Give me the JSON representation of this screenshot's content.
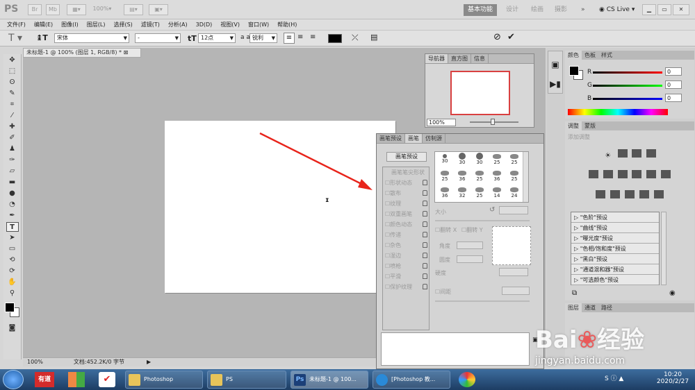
{
  "app": {
    "logo": "PS",
    "zoom": "100%",
    "workspaces": [
      "基本功能",
      "设计",
      "绘画",
      "摄影"
    ],
    "cslive": "CS Live"
  },
  "menu": [
    "文件(F)",
    "编辑(E)",
    "图像(I)",
    "图层(L)",
    "选择(S)",
    "滤镜(T)",
    "分析(A)",
    "3D(D)",
    "视图(V)",
    "窗口(W)",
    "帮助(H)"
  ],
  "options": {
    "font_family": "宋体",
    "font_style": "-",
    "font_size": "12点",
    "aa_label": "a a",
    "antialias": "锐利"
  },
  "document": {
    "tab": "未标题-1 @ 100% (图层 1, RGB/8) *",
    "zoom": "100%",
    "status": "文档:452.2K/0 字节"
  },
  "navigator": {
    "tabs": [
      "导航器",
      "直方图",
      "信息"
    ],
    "zoom": "100%"
  },
  "brush": {
    "tabs": [
      "画笔预设",
      "画笔",
      "仿制源"
    ],
    "preset_button": "画笔预设",
    "items": [
      "画笔笔尖形状",
      "形状动态",
      "散布",
      "纹理",
      "双重画笔",
      "颜色动态",
      "传递",
      "杂色",
      "湿边",
      "喷枪",
      "平滑",
      "保护纹理"
    ],
    "sizes": [
      [
        "30",
        "30",
        "30",
        "25",
        "25"
      ],
      [
        "25",
        "36",
        "25",
        "36",
        "25"
      ],
      [
        "36",
        "32",
        "25",
        "14",
        "24"
      ]
    ],
    "size_label": "大小",
    "flip_x": "翻转 X",
    "flip_y": "翻转 Y",
    "angle": "角度",
    "roundness": "圆度",
    "hardness": "硬度",
    "spacing": "间距"
  },
  "color": {
    "tabs": [
      "颜色",
      "色板",
      "样式"
    ],
    "r_label": "R",
    "g_label": "G",
    "b_label": "B",
    "r": "0",
    "g": "0",
    "b": "0"
  },
  "adjust": {
    "tabs": [
      "调整",
      "蒙版"
    ],
    "heading": "添加调整",
    "presets": [
      "\"色阶\"预设",
      "\"曲线\"预设",
      "\"曝光度\"预设",
      "\"色相/饱和度\"预设",
      "\"黑白\"预设",
      "\"通道混和器\"预设",
      "\"可选颜色\"预设"
    ]
  },
  "layers": {
    "tabs": [
      "图层",
      "通道",
      "路径"
    ]
  },
  "watermark": {
    "brand": "Bai",
    "brand2": "经验",
    "url": "jingyan.baidu.com"
  },
  "taskbar": {
    "items": [
      "有道",
      "Photoshop",
      "PS",
      "未标题-1 @ 100...",
      "[Photoshop 教..."
    ],
    "time": "10:20",
    "date": "2020/2/27"
  },
  "colors": {
    "arrow": "#e8241b",
    "taskbar": "#1d3d63"
  }
}
